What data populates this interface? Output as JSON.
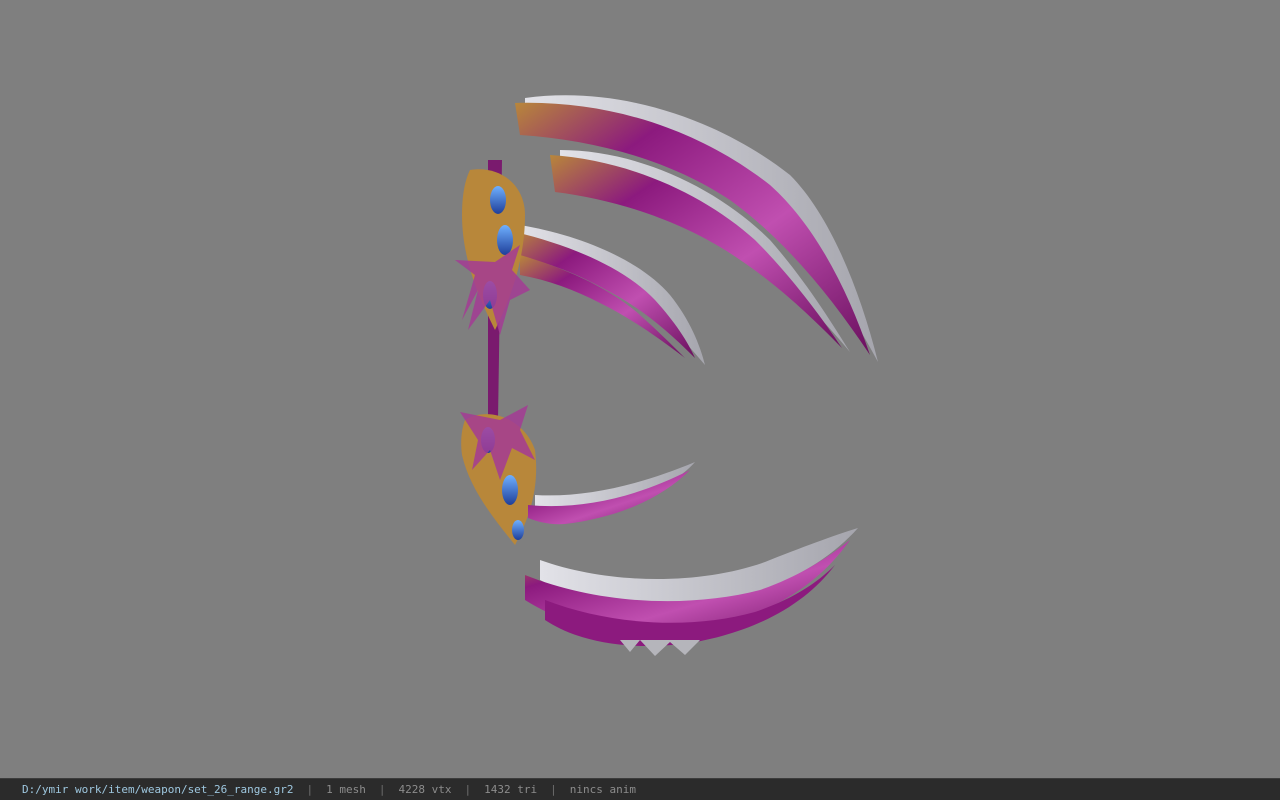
{
  "viewport": {
    "background": "#7f7f7f",
    "model": {
      "type": "3d-weapon-mesh",
      "colors": {
        "blade_main": "#8c1a7e",
        "blade_highlight": "#c04fb0",
        "edge_metal": "#c9c9cf",
        "gold_trim": "#b8873a",
        "gem_blue": "#2f67c7"
      }
    }
  },
  "statusbar": {
    "path": "D:/ymir work/item/weapon/set_26_range.gr2",
    "mesh_count": "1 mesh",
    "vertex_count": "4228 vtx",
    "triangle_count": "1432 tri",
    "anim_status": "nincs anim",
    "separator": "|"
  }
}
